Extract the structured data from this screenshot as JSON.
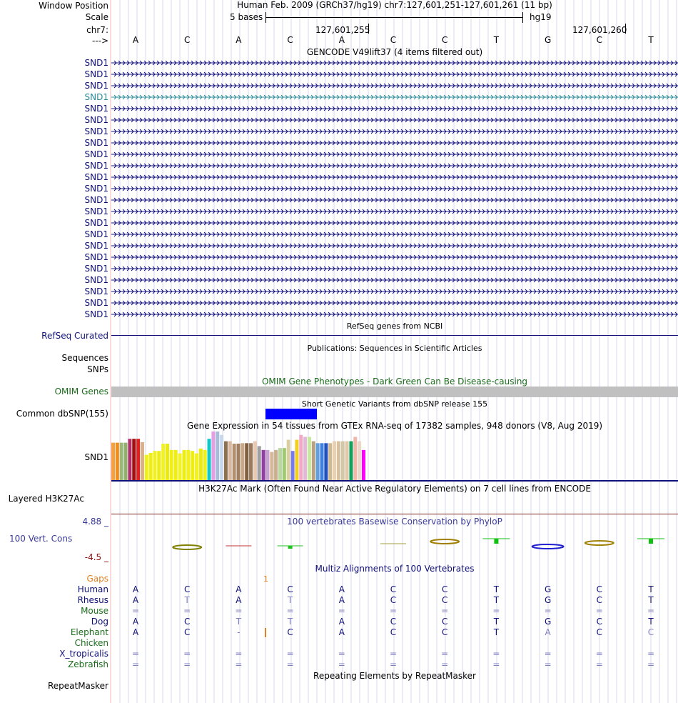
{
  "header": {
    "window_position_label": "Window Position",
    "scale_label": "Scale",
    "chrom_label": "chr7:",
    "strand_label": "--->",
    "assembly_title": "Human Feb. 2009 (GRCh37/hg19)   chr7:127,601,251-127,601,261 (11 bp)",
    "scale_text": "5 bases",
    "assembly_tag": "hg19",
    "coord_1": "127,601,255",
    "coord_2": "127,601,260"
  },
  "sequence": [
    "A",
    "C",
    "A",
    "C",
    "A",
    "C",
    "C",
    "T",
    "G",
    "C",
    "T"
  ],
  "gencode": {
    "title": "GENCODE V49lift37 (4 items filtered out)",
    "gene_name": "SND1",
    "row_count": 23,
    "highlight_row": 3,
    "color": "#10107a",
    "highlight_color": "#2b8a9a"
  },
  "refseq": {
    "label": "RefSeq Curated",
    "title": "RefSeq genes from NCBI"
  },
  "publications": {
    "title": "Publications: Sequences in Scientific Articles",
    "label_1": "Sequences",
    "label_2": "SNPs"
  },
  "omim": {
    "label": "OMIM Genes",
    "title": "OMIM Gene Phenotypes - Dark Green Can Be Disease-causing",
    "color": "#1a6b1a"
  },
  "dbsnp": {
    "label": "Common dbSNP(155)",
    "title": "Short Genetic Variants from dbSNP release 155",
    "color": "#0000ff"
  },
  "gtex": {
    "title": "Gene Expression in 54 tissues from GTEx RNA-seq of 17382 samples, 948 donors (V8, Aug 2019)",
    "gene_label": "SND1",
    "bars": [
      {
        "c": "#f4a040",
        "v": 0.77
      },
      {
        "c": "#f08c20",
        "v": 0.77
      },
      {
        "c": "#9bb87a",
        "v": 0.77
      },
      {
        "c": "#8fb06e",
        "v": 0.77
      },
      {
        "c": "#b0306a",
        "v": 0.85
      },
      {
        "c": "#a01010",
        "v": 0.85
      },
      {
        "c": "#e02020",
        "v": 0.85
      },
      {
        "c": "#d8b08a",
        "v": 0.78
      },
      {
        "c": "#f0f018",
        "v": 0.52
      },
      {
        "c": "#eeee10",
        "v": 0.56
      },
      {
        "c": "#f0f020",
        "v": 0.6
      },
      {
        "c": "#ecec14",
        "v": 0.6
      },
      {
        "c": "#f2f222",
        "v": 0.75
      },
      {
        "c": "#eaea10",
        "v": 0.75
      },
      {
        "c": "#f0f018",
        "v": 0.62
      },
      {
        "c": "#eeee12",
        "v": 0.62
      },
      {
        "c": "#f2f228",
        "v": 0.55
      },
      {
        "c": "#ecec16",
        "v": 0.62
      },
      {
        "c": "#f0f01a",
        "v": 0.62
      },
      {
        "c": "#eeee14",
        "v": 0.6
      },
      {
        "c": "#f2f220",
        "v": 0.55
      },
      {
        "c": "#eaea10",
        "v": 0.65
      },
      {
        "c": "#f0f018",
        "v": 0.62
      },
      {
        "c": "#10c8c8",
        "v": 0.85
      },
      {
        "c": "#e49ee4",
        "v": 1.0
      },
      {
        "c": "#a6bcd8",
        "v": 1.0
      },
      {
        "c": "#c8d8ec",
        "v": 0.93
      },
      {
        "c": "#8e7050",
        "v": 0.8
      },
      {
        "c": "#d8b8a0",
        "v": 0.8
      },
      {
        "c": "#b09070",
        "v": 0.75
      },
      {
        "c": "#a08060",
        "v": 0.75
      },
      {
        "c": "#c8a888",
        "v": 0.76
      },
      {
        "c": "#806040",
        "v": 0.76
      },
      {
        "c": "#9a7a5a",
        "v": 0.76
      },
      {
        "c": "#e8c8b0",
        "v": 0.8
      },
      {
        "c": "#a0a0a0",
        "v": 0.7
      },
      {
        "c": "#9040a0",
        "v": 0.62
      },
      {
        "c": "#c8a0d0",
        "v": 0.62
      },
      {
        "c": "#d8b898",
        "v": 0.58
      },
      {
        "c": "#c8b08c",
        "v": 0.62
      },
      {
        "c": "#b8d8a0",
        "v": 0.66
      },
      {
        "c": "#a0c870",
        "v": 0.66
      },
      {
        "c": "#d8d0a0",
        "v": 0.83
      },
      {
        "c": "#7878f0",
        "v": 0.6
      },
      {
        "c": "#f0d020",
        "v": 0.83
      },
      {
        "c": "#f4a8c8",
        "v": 0.93
      },
      {
        "c": "#e0b8d8",
        "v": 0.89
      },
      {
        "c": "#c8e8a0",
        "v": 0.89
      },
      {
        "c": "#b8a080",
        "v": 0.8
      },
      {
        "c": "#60a0e0",
        "v": 0.76
      },
      {
        "c": "#4080e0",
        "v": 0.76
      },
      {
        "c": "#2050c0",
        "v": 0.76
      },
      {
        "c": "#d0b890",
        "v": 0.76
      },
      {
        "c": "#e8d0b0",
        "v": 0.8
      },
      {
        "c": "#d8c0a0",
        "v": 0.8
      },
      {
        "c": "#d0c8a8",
        "v": 0.8
      },
      {
        "c": "#e0c8a8",
        "v": 0.8
      },
      {
        "c": "#10a060",
        "v": 0.8
      },
      {
        "c": "#f0b8a8",
        "v": 0.89
      },
      {
        "c": "#e8d8c8",
        "v": 0.8
      },
      {
        "c": "#ff00ff",
        "v": 0.62
      }
    ]
  },
  "h3k27ac": {
    "label": "Layered H3K27Ac",
    "title": "H3K27Ac Mark (Often Found Near Active Regulatory Elements) on 7 cell lines from ENCODE",
    "color": "#802020"
  },
  "phylop": {
    "label": "100 Vert. Cons",
    "title": "100 vertebrates Basewise Conservation by PhyloP",
    "max_label": "4.88 _",
    "min_label": "-4.5 _",
    "label_color": "#3a3a9a",
    "min_color": "#8b1010"
  },
  "multiz": {
    "title": "Multiz Alignments of 100 Vertebrates",
    "gaps_label": "Gaps",
    "gap_marker": "1",
    "species": [
      {
        "name": "Human",
        "color": "#10107a",
        "bases": [
          "A",
          "C",
          "A",
          "C",
          "A",
          "C",
          "C",
          "T",
          "G",
          "C",
          "T"
        ],
        "faint": []
      },
      {
        "name": "Rhesus",
        "color": "#10107a",
        "bases": [
          "A",
          "T",
          "A",
          "T",
          "A",
          "C",
          "C",
          "T",
          "G",
          "C",
          "T"
        ],
        "faint": [
          1,
          3
        ]
      },
      {
        "name": "Mouse",
        "color": "#1a6b1a",
        "bases": [
          "=",
          "=",
          "=",
          "=",
          "=",
          "=",
          "=",
          "=",
          "=",
          "=",
          "="
        ],
        "faint": [
          0,
          1,
          2,
          3,
          4,
          5,
          6,
          7,
          8,
          9,
          10
        ]
      },
      {
        "name": "Dog",
        "color": "#10107a",
        "bases": [
          "A",
          "C",
          "T",
          "T",
          "A",
          "C",
          "C",
          "T",
          "G",
          "C",
          "T"
        ],
        "faint": [
          2,
          3
        ]
      },
      {
        "name": "Elephant",
        "color": "#1a6b1a",
        "bases": [
          "A",
          "C",
          "-",
          "C",
          "A",
          "C",
          "C",
          "T",
          "A",
          "C",
          "C"
        ],
        "faint": [
          2,
          8,
          10
        ]
      },
      {
        "name": "Chicken",
        "color": "#1a6b1a",
        "bases": [
          "",
          "",
          "",
          "",
          "",
          "",
          "",
          "",
          "",
          "",
          ""
        ],
        "faint": []
      },
      {
        "name": "X_tropicalis",
        "color": "#10107a",
        "bases": [
          "=",
          "=",
          "=",
          "=",
          "=",
          "=",
          "=",
          "=",
          "=",
          "=",
          "="
        ],
        "faint": [
          0,
          1,
          2,
          3,
          4,
          5,
          6,
          7,
          8,
          9,
          10
        ]
      },
      {
        "name": "Zebrafish",
        "color": "#1a6b1a",
        "bases": [
          "=",
          "=",
          "=",
          "=",
          "=",
          "=",
          "=",
          "=",
          "=",
          "=",
          "="
        ],
        "faint": [
          0,
          1,
          2,
          3,
          4,
          5,
          6,
          7,
          8,
          9,
          10
        ]
      }
    ]
  },
  "repeatmasker": {
    "label": "RepeatMasker",
    "title": "Repeating Elements by RepeatMasker"
  }
}
